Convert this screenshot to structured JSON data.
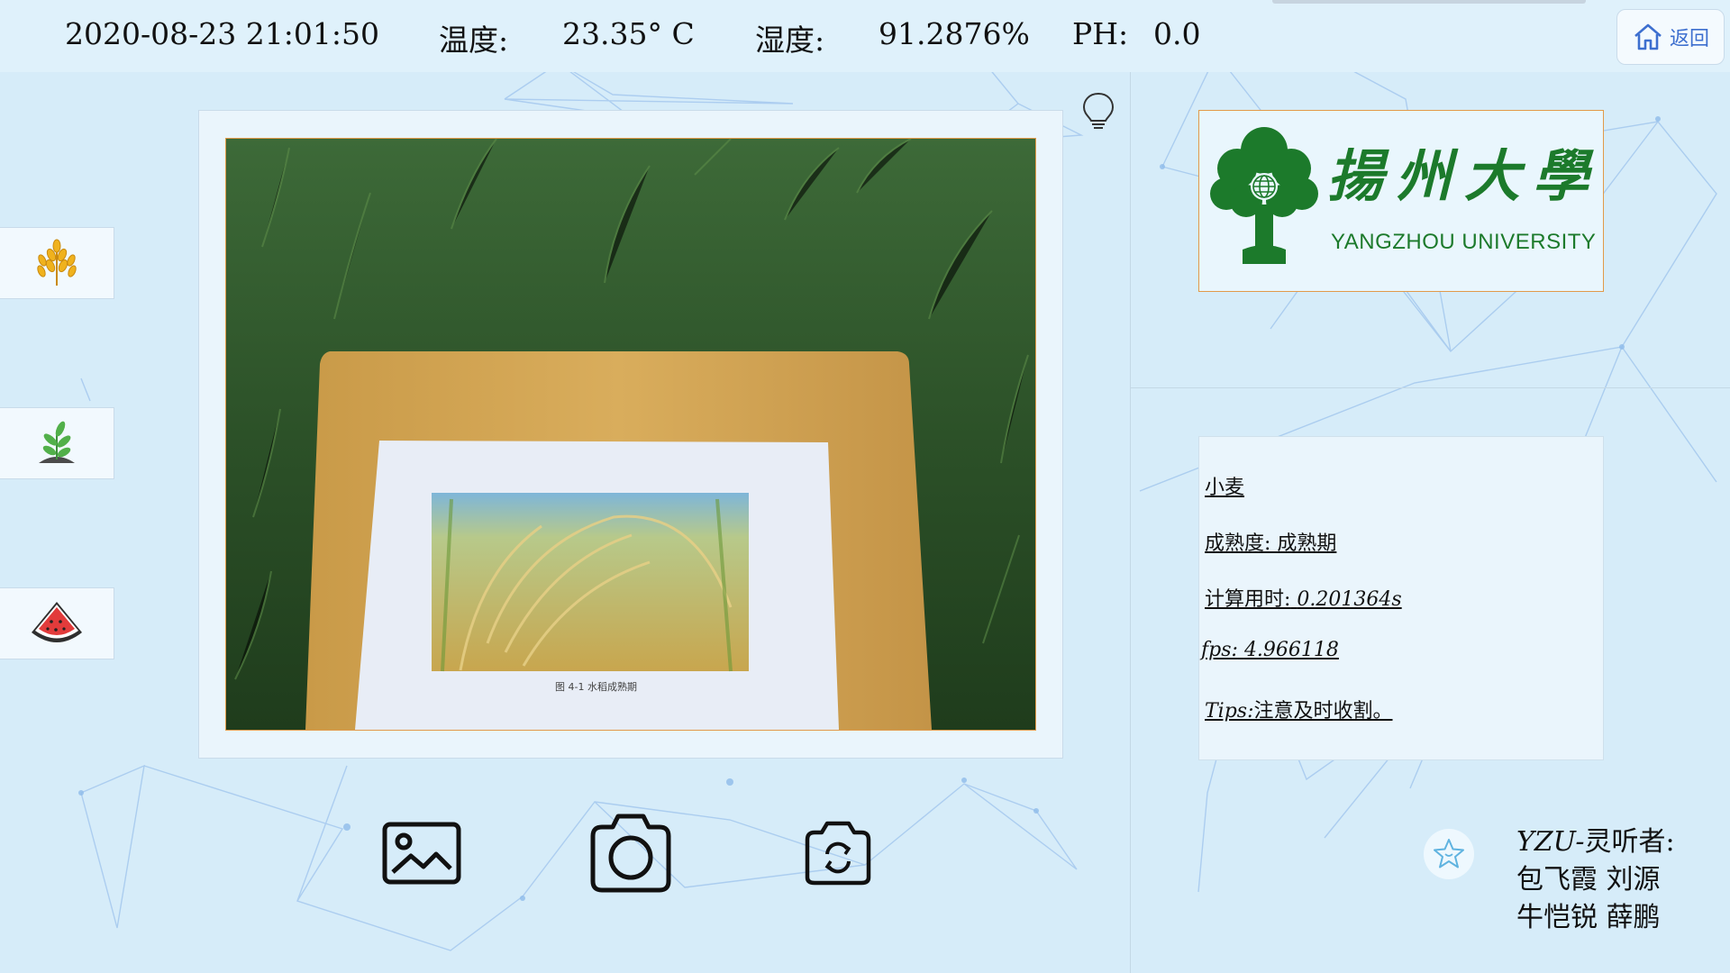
{
  "status": {
    "datetime": "2020-08-23 21:01:50",
    "temperature_label": "温度:",
    "temperature_value": "23.35° C",
    "humidity_label": "湿度:",
    "humidity_value": "91.2876%",
    "ph_label": "PH:",
    "ph_value": "0.0"
  },
  "nav": {
    "home_label": "返回",
    "home_icon": "home-icon"
  },
  "categories": [
    {
      "name": "wheat",
      "icon": "wheat-icon"
    },
    {
      "name": "seedling",
      "icon": "seedling-icon"
    },
    {
      "name": "watermelon",
      "icon": "watermelon-icon"
    }
  ],
  "camera": {
    "photo_caption": "图 4-1 水稻成熟期"
  },
  "logo": {
    "chinese_name": "揚州大學",
    "english_name": "YANGZHOU UNIVERSITY"
  },
  "result": {
    "crop": "小麦",
    "maturity": "成熟度: 成熟期",
    "compute_time_label": "计算用时:",
    "compute_time_value": "0.201364s",
    "fps_label": "fps:",
    "fps_value": "4.966118",
    "tips_label": "Tips:",
    "tips_value": "注意及时收割。"
  },
  "actions": [
    {
      "name": "gallery",
      "icon": "image-icon"
    },
    {
      "name": "capture",
      "icon": "camera-icon"
    },
    {
      "name": "switch-camera",
      "icon": "switch-camera-icon"
    }
  ],
  "credits": {
    "team_prefix": "YZU-",
    "team_suffix": "灵听者:",
    "members_line1": "包飞霞 刘源",
    "members_line2": "牛恺锐 薛鹏"
  },
  "colors": {
    "background": "#d6ecf9",
    "accent_border": "#e29a4a",
    "logo_green": "#1c7a2b",
    "home_blue": "#3d6fcf"
  }
}
